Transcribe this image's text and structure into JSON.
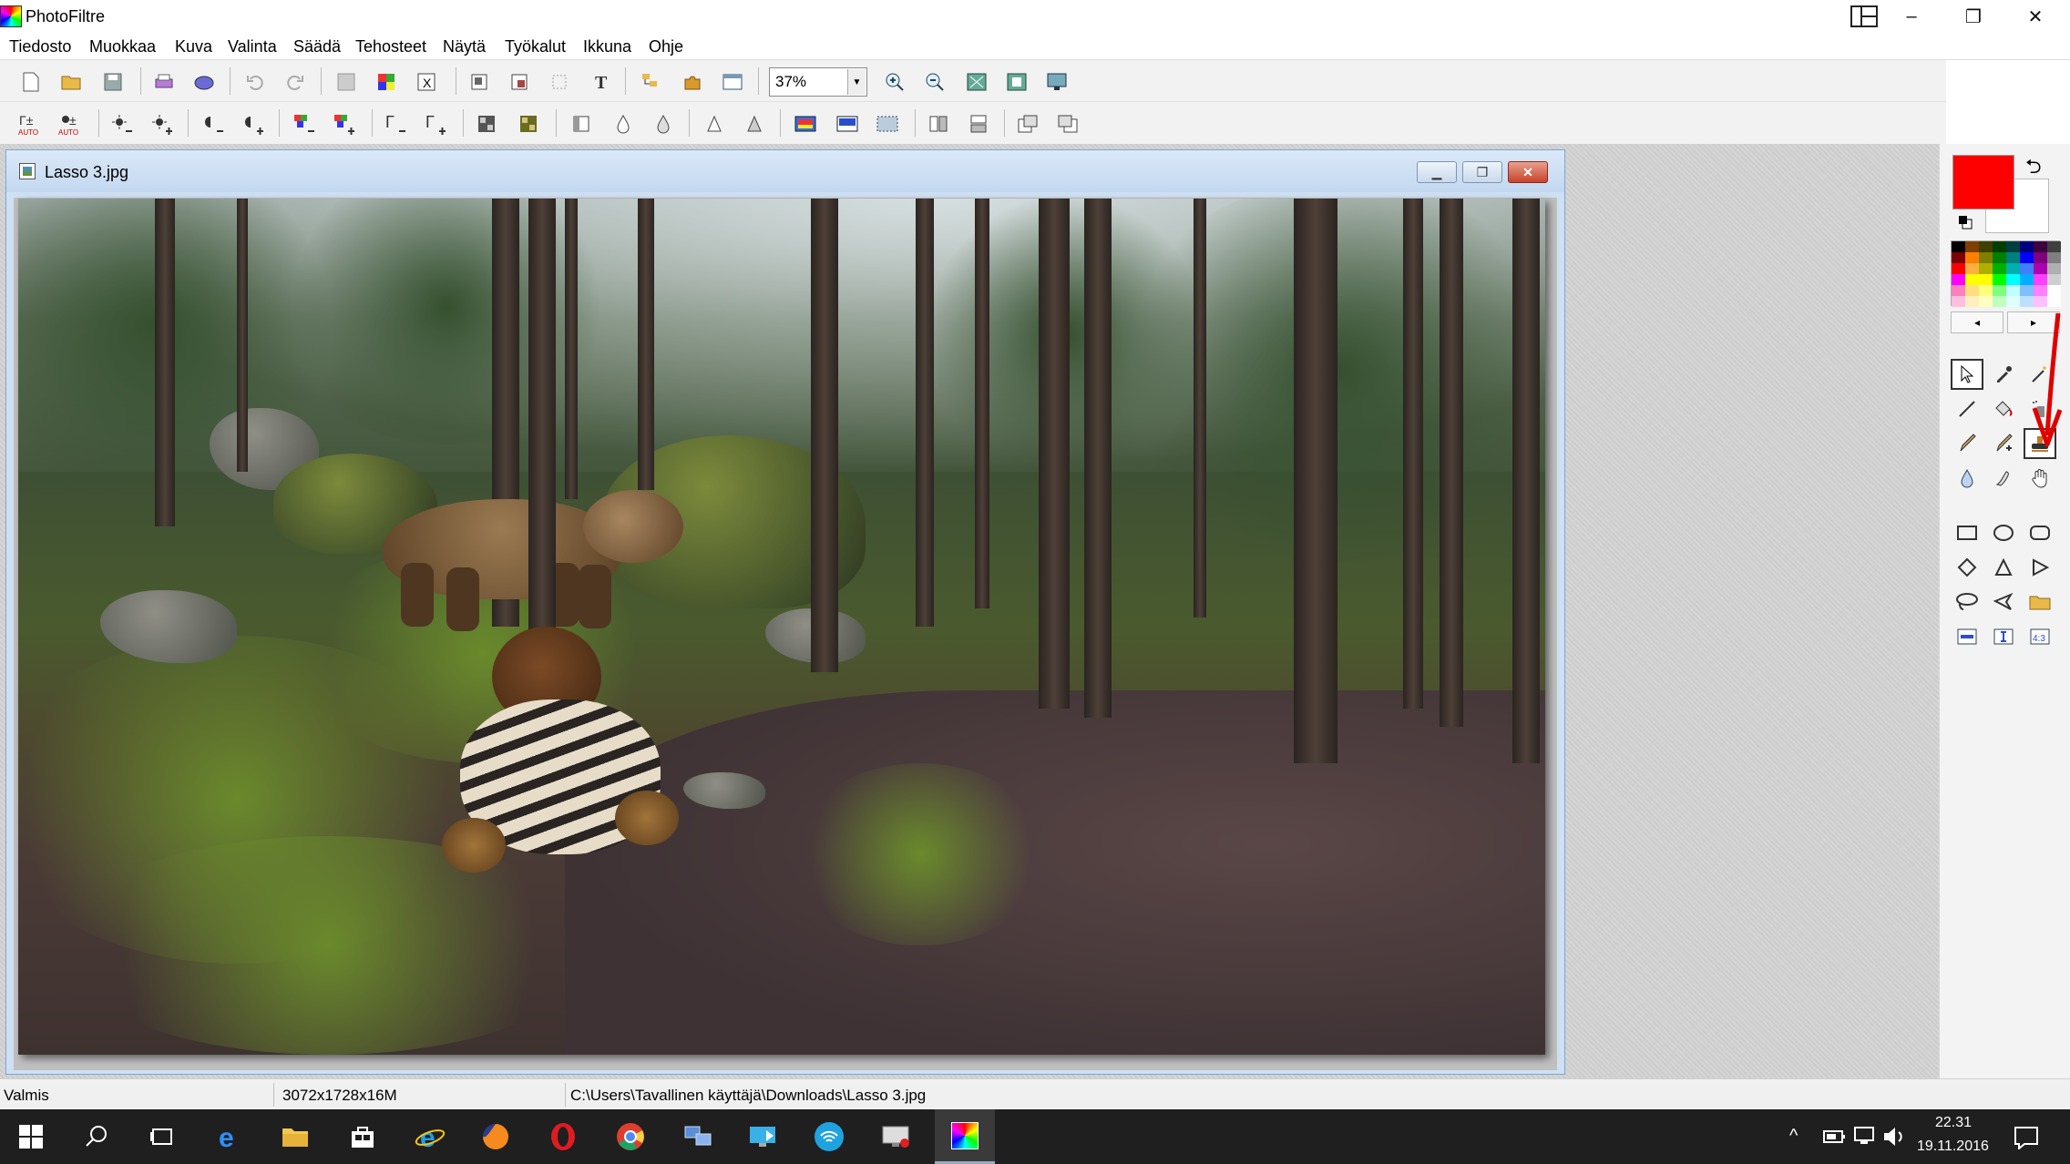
{
  "app": {
    "title": "PhotoFiltre"
  },
  "window_controls": {
    "snap": "snap-layout",
    "minimize": "–",
    "maximize": "❐",
    "close": "✕"
  },
  "menu": [
    "Tiedosto",
    "Muokkaa",
    "Kuva",
    "Valinta",
    "Säädä",
    "Tehosteet",
    "Näytä",
    "Työkalut",
    "Ikkuna",
    "Ohje"
  ],
  "toolbar": {
    "zoom_value": "37%"
  },
  "document": {
    "title": "Lasso 3.jpg"
  },
  "colors": {
    "foreground": "#ff0000",
    "background": "#ffffff",
    "annotation_arrow": "#e00000"
  },
  "palette_nav": {
    "prev": "◂",
    "next": "▸"
  },
  "tools": [
    "selection-icon",
    "eyedropper-icon",
    "magic-wand-icon",
    "line-icon",
    "fill-bucket-icon",
    "spray-icon",
    "brush-icon",
    "advanced-brush-icon",
    "clone-stamp-icon",
    "blur-drop-icon",
    "smudge-finger-icon",
    "hand-icon"
  ],
  "shapes": [
    "rectangle-icon",
    "ellipse-icon",
    "rounded-rectangle-icon",
    "diamond-icon",
    "triangle-icon",
    "right-triangle-icon",
    "lasso-icon",
    "polygon-lasso-icon",
    "open-folder-icon",
    "fixed-ratio-icon",
    "text-frame-icon",
    "ratio-43-icon"
  ],
  "status": {
    "state": "Valmis",
    "dimensions": "3072x1728x16M",
    "path": "C:\\Users\\Tavallinen käyttäjä\\Downloads\\Lasso 3.jpg"
  },
  "taskbar": {
    "time": "22.31",
    "date": "19.11.2016"
  }
}
